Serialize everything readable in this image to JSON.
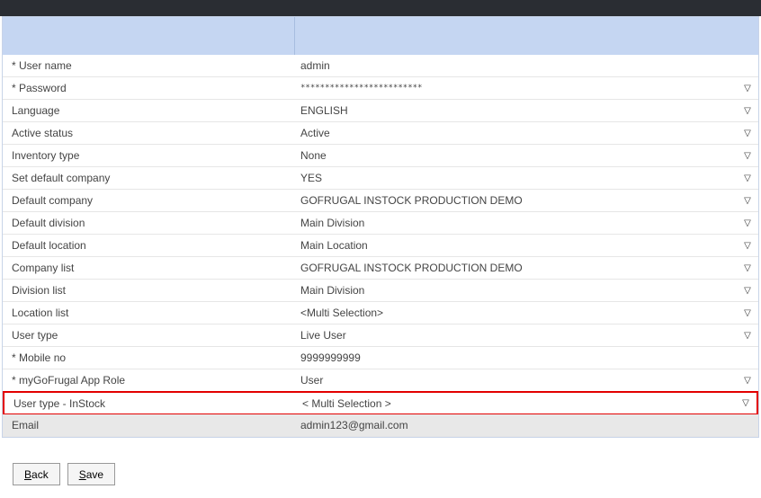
{
  "rows": [
    {
      "label": "* User name",
      "value": "admin",
      "dropdown": false
    },
    {
      "label": "* Password",
      "value": "*************************",
      "dropdown": true,
      "pw": true
    },
    {
      "label": "Language",
      "value": "ENGLISH",
      "dropdown": true
    },
    {
      "label": "Active status",
      "value": "Active",
      "dropdown": true
    },
    {
      "label": "Inventory type",
      "value": "None",
      "dropdown": true
    },
    {
      "label": "Set default company",
      "value": "YES",
      "dropdown": true
    },
    {
      "label": "Default company",
      "value": "GOFRUGAL INSTOCK PRODUCTION DEMO",
      "dropdown": true
    },
    {
      "label": "Default division",
      "value": "Main Division",
      "dropdown": true
    },
    {
      "label": "Default location",
      "value": "Main Location",
      "dropdown": true
    },
    {
      "label": "Company list",
      "value": "GOFRUGAL INSTOCK PRODUCTION DEMO",
      "dropdown": true
    },
    {
      "label": "Division list",
      "value": "Main Division",
      "dropdown": true
    },
    {
      "label": "Location list",
      "value": "<Multi Selection>",
      "dropdown": true
    },
    {
      "label": "User type",
      "value": "Live User",
      "dropdown": true
    },
    {
      "label": "* Mobile no",
      "value": "9999999999",
      "dropdown": false
    },
    {
      "label": "* myGoFrugal App Role",
      "value": "User",
      "dropdown": true
    }
  ],
  "highlight": {
    "label": "User type - InStock",
    "value": "< Multi Selection >",
    "dropdown": true
  },
  "emailRow": {
    "label": "Email",
    "value": "admin123@gmail.com",
    "dropdown": false
  },
  "buttons": {
    "back": "Back",
    "save": "Save"
  },
  "dropdownGlyph": "▽"
}
